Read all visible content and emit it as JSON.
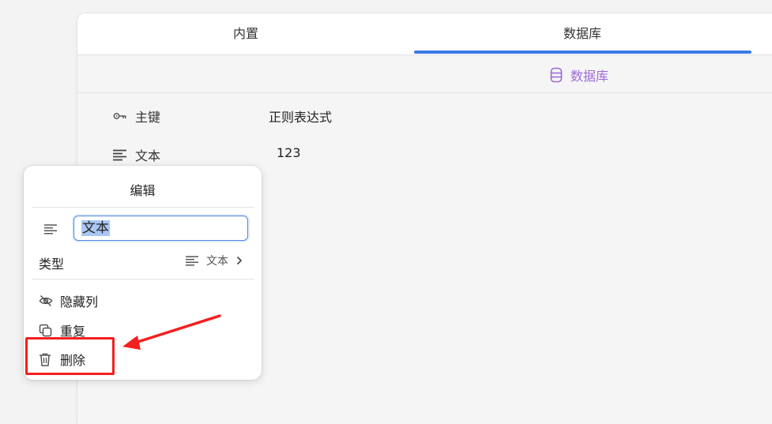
{
  "tabs": [
    {
      "label": "内置",
      "active": false
    },
    {
      "label": "数据库",
      "active": true
    }
  ],
  "database_link": {
    "label": "数据库",
    "icon": "database-icon",
    "color": "#9b6bd6"
  },
  "fields": [
    {
      "icon": "key-icon",
      "name": "主键",
      "value": "正则表达式"
    },
    {
      "icon": "text-lines-icon",
      "name": "文本",
      "value": "123"
    }
  ],
  "edit_popup": {
    "title": "编辑",
    "name_input": {
      "value": "文本",
      "icon": "text-lines-icon"
    },
    "type": {
      "label": "类型",
      "value": "文本",
      "icon": "text-lines-icon"
    },
    "menu": [
      {
        "label": "隐藏列",
        "icon": "eye-off-icon"
      },
      {
        "label": "重复",
        "icon": "duplicate-icon"
      },
      {
        "label": "删除",
        "icon": "trash-icon"
      }
    ]
  },
  "annotation": {
    "color": "#f41f1f"
  },
  "accent_color": "#3b78e7"
}
